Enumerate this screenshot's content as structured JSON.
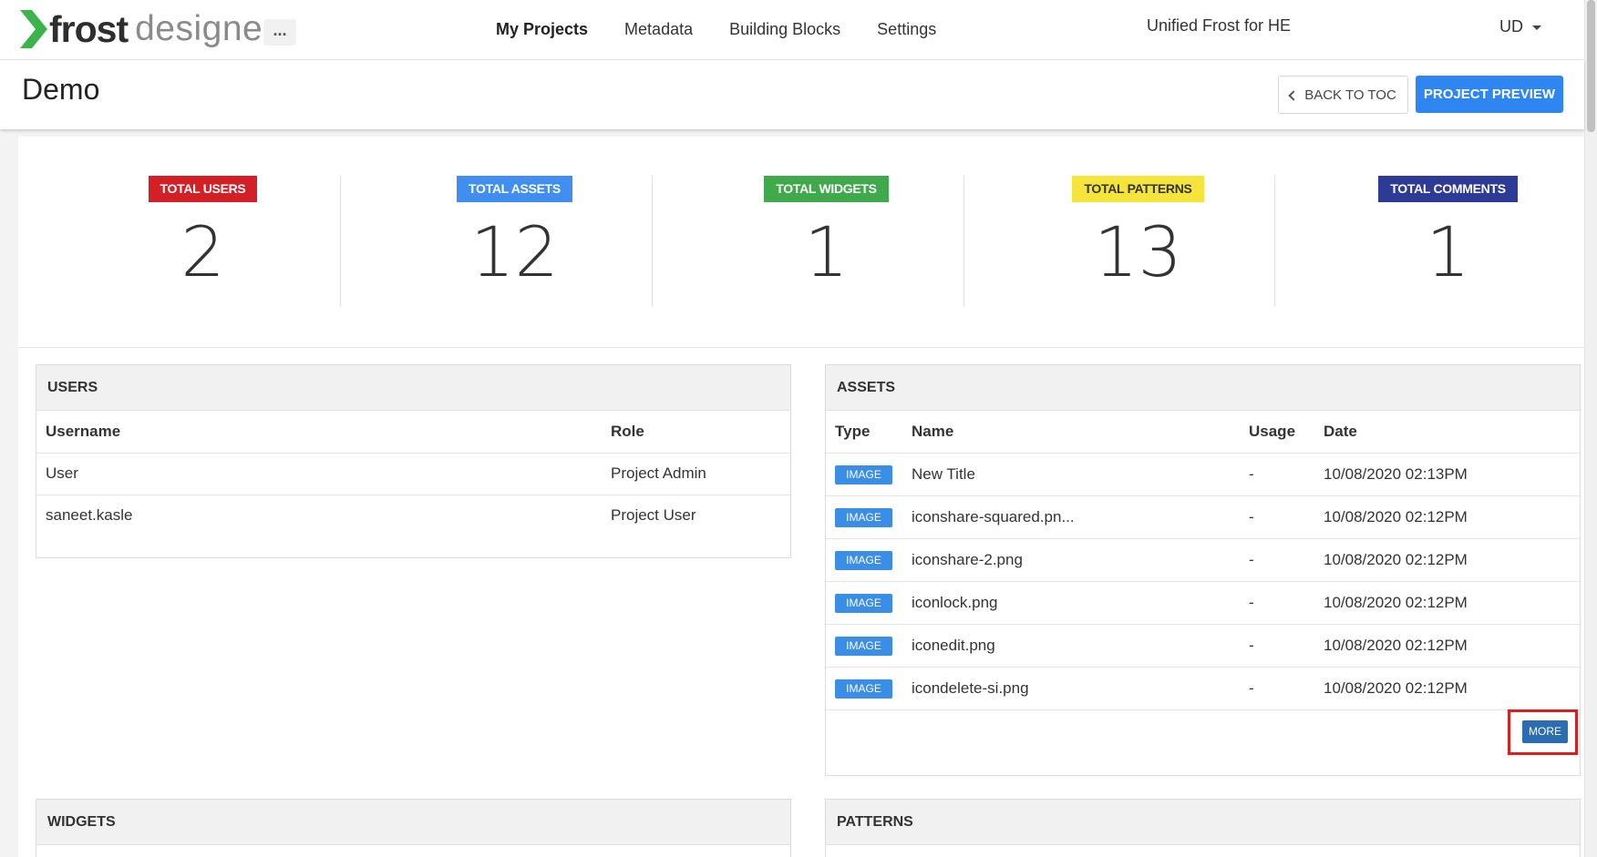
{
  "app": {
    "logo_frost": "frost",
    "logo_designer": "designer",
    "more_dots": "...",
    "nav": [
      {
        "label": "My Projects",
        "active": true
      },
      {
        "label": "Metadata",
        "active": false
      },
      {
        "label": "Building Blocks",
        "active": false
      },
      {
        "label": "Settings",
        "active": false
      }
    ],
    "org_name": "Unified Frost for HE",
    "user_initials": "UD"
  },
  "page": {
    "title": "Demo",
    "back_label": "BACK TO TOC",
    "preview_label": "PROJECT PREVIEW"
  },
  "stats": [
    {
      "label": "TOTAL USERS",
      "value": "2",
      "color": "#d32027",
      "text_color": "#ffffff"
    },
    {
      "label": "TOTAL ASSETS",
      "value": "12",
      "color": "#3f8ef0",
      "text_color": "#ffffff"
    },
    {
      "label": "TOTAL WIDGETS",
      "value": "1",
      "color": "#3fa94c",
      "text_color": "#ffffff"
    },
    {
      "label": "TOTAL PATTERNS",
      "value": "13",
      "color": "#f5e53b",
      "text_color": "#333333"
    },
    {
      "label": "TOTAL COMMENTS",
      "value": "1",
      "color": "#2d3b97",
      "text_color": "#ffffff"
    }
  ],
  "users": {
    "title": "USERS",
    "columns": [
      "Username",
      "Role"
    ],
    "rows": [
      {
        "username": "User",
        "role": "Project Admin"
      },
      {
        "username": "saneet.kasle",
        "role": "Project User"
      }
    ]
  },
  "assets": {
    "title": "ASSETS",
    "columns": [
      "Type",
      "Name",
      "Usage",
      "Date"
    ],
    "rows": [
      {
        "type": "IMAGE",
        "name": "New Title",
        "usage": "-",
        "date": "10/08/2020 02:13PM"
      },
      {
        "type": "IMAGE",
        "name": "iconshare-squared.pn...",
        "usage": "-",
        "date": "10/08/2020 02:12PM"
      },
      {
        "type": "IMAGE",
        "name": "iconshare-2.png",
        "usage": "-",
        "date": "10/08/2020 02:12PM"
      },
      {
        "type": "IMAGE",
        "name": "iconlock.png",
        "usage": "-",
        "date": "10/08/2020 02:12PM"
      },
      {
        "type": "IMAGE",
        "name": "iconedit.png",
        "usage": "-",
        "date": "10/08/2020 02:12PM"
      },
      {
        "type": "IMAGE",
        "name": "icondelete-si.png",
        "usage": "-",
        "date": "10/08/2020 02:12PM"
      }
    ],
    "more_label": "MORE"
  },
  "widgets": {
    "title": "WIDGETS"
  },
  "patterns": {
    "title": "PATTERNS"
  }
}
